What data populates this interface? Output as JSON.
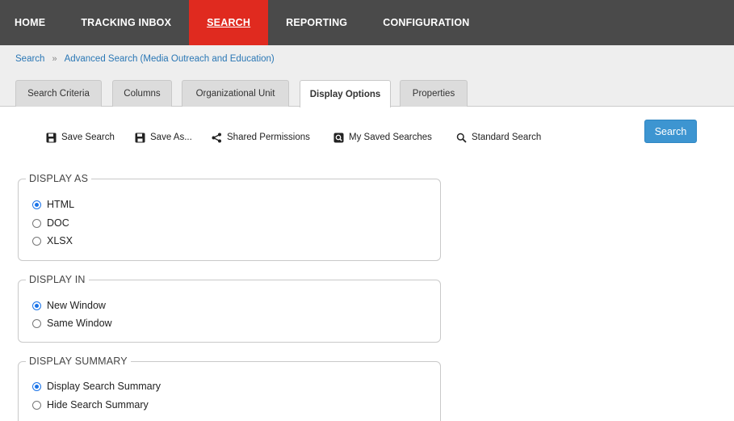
{
  "nav": {
    "items": [
      {
        "label": "HOME",
        "active": false
      },
      {
        "label": "TRACKING INBOX",
        "active": false
      },
      {
        "label": "SEARCH",
        "active": true
      },
      {
        "label": "REPORTING",
        "active": false
      },
      {
        "label": "CONFIGURATION",
        "active": false
      }
    ]
  },
  "breadcrumb": {
    "root": "Search",
    "separator": "»",
    "current": "Advanced Search (Media Outreach and Education)"
  },
  "tabs": [
    {
      "label": "Search Criteria",
      "active": false
    },
    {
      "label": "Columns",
      "active": false
    },
    {
      "label": "Organizational Unit",
      "active": false
    },
    {
      "label": "Display Options",
      "active": true
    },
    {
      "label": "Properties",
      "active": false
    }
  ],
  "toolbar": {
    "save_search": {
      "label": "Save Search",
      "icon": "floppy-disk-icon"
    },
    "save_as": {
      "label": "Save As...",
      "icon": "floppy-disk-icon"
    },
    "shared_permissions": {
      "label": "Shared Permissions",
      "icon": "share-icon"
    },
    "my_saved_searches": {
      "label": "My Saved Searches",
      "icon": "saved-searches-icon"
    },
    "standard_search": {
      "label": "Standard Search",
      "icon": "search-icon"
    }
  },
  "search_button": {
    "label": "Search"
  },
  "display_as": {
    "legend": "DISPLAY AS",
    "options": [
      {
        "label": "HTML",
        "selected": true
      },
      {
        "label": "DOC",
        "selected": false
      },
      {
        "label": "XLSX",
        "selected": false
      }
    ]
  },
  "display_in": {
    "legend": "DISPLAY IN",
    "options": [
      {
        "label": "New Window",
        "selected": true
      },
      {
        "label": "Same Window",
        "selected": false
      }
    ]
  },
  "display_summary": {
    "legend": "DISPLAY SUMMARY",
    "options": [
      {
        "label": "Display Search Summary",
        "selected": true
      },
      {
        "label": "Hide Search Summary",
        "selected": false
      }
    ]
  },
  "colors": {
    "nav_bg": "#4a4a4a",
    "nav_active": "#e02a1f",
    "link": "#2a77b5",
    "button": "#3d95d1",
    "radio_selected": "#1a73e8"
  }
}
